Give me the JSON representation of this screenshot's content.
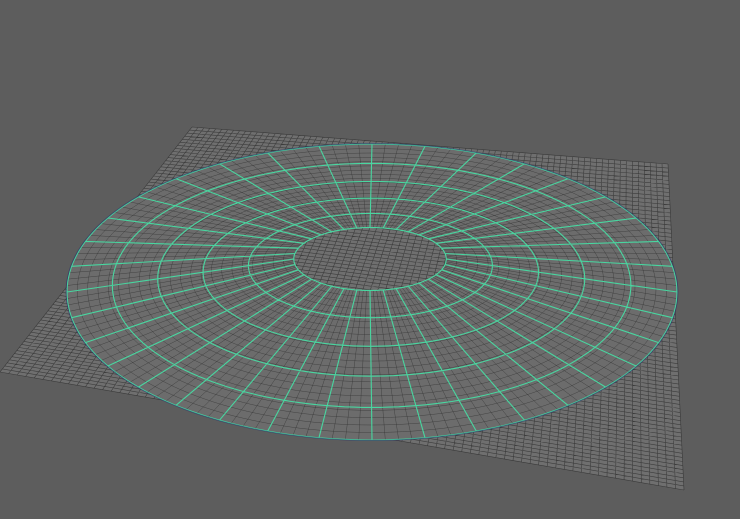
{
  "viewport": {
    "background_color": "#5d5d5d",
    "camera": "perspective"
  },
  "ground_plane": {
    "type": "polygon-plane",
    "subdivisions": 80,
    "fill_color": "#6f6f6f",
    "wire_color": "#2b2b2b"
  },
  "selected_object": {
    "type": "nurbs-disc",
    "selected": true,
    "outer_radius": 1.0,
    "inner_radius": 0.25,
    "radial_spans": 5,
    "angular_sections": 36,
    "isoparm_color": "#49d6a0",
    "surface_color": "#6c6c6c",
    "highlight_edge_color": "#2a2a68"
  }
}
